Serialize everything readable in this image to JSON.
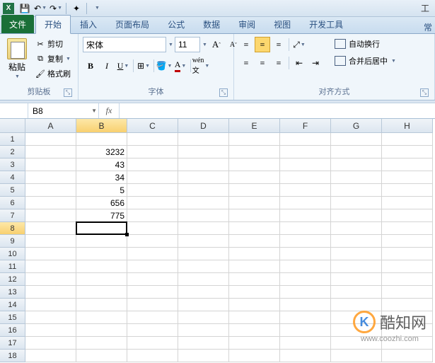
{
  "titlebar": {
    "right_text": "工"
  },
  "tabs": {
    "file": "文件",
    "items": [
      "开始",
      "插入",
      "页面布局",
      "公式",
      "数据",
      "审阅",
      "视图",
      "开发工具"
    ],
    "active_index": 0,
    "right_text": "常"
  },
  "ribbon": {
    "clipboard": {
      "paste": "粘贴",
      "cut": "剪切",
      "copy": "复制",
      "format_painter": "格式刷",
      "label": "剪贴板"
    },
    "font": {
      "name": "宋体",
      "size": "11",
      "label": "字体"
    },
    "alignment": {
      "wrap_text": "自动换行",
      "merge_center": "合并后居中",
      "label": "对齐方式"
    }
  },
  "namebox": {
    "value": "B8"
  },
  "formula": {
    "fx": "fx",
    "value": ""
  },
  "columns": [
    "A",
    "B",
    "C",
    "D",
    "E",
    "F",
    "G",
    "H"
  ],
  "rows": [
    "1",
    "2",
    "3",
    "4",
    "5",
    "6",
    "7",
    "8",
    "9",
    "10",
    "11",
    "12",
    "13",
    "14",
    "15",
    "16",
    "17",
    "18"
  ],
  "cells": {
    "B2": "3232",
    "B3": "43",
    "B4": "34",
    "B5": "5",
    "B6": "656",
    "B7": "775"
  },
  "selection": {
    "col": "B",
    "row": 8
  },
  "watermark": {
    "text": "酷知网",
    "url": "www.coozhi.com",
    "k": "K"
  }
}
